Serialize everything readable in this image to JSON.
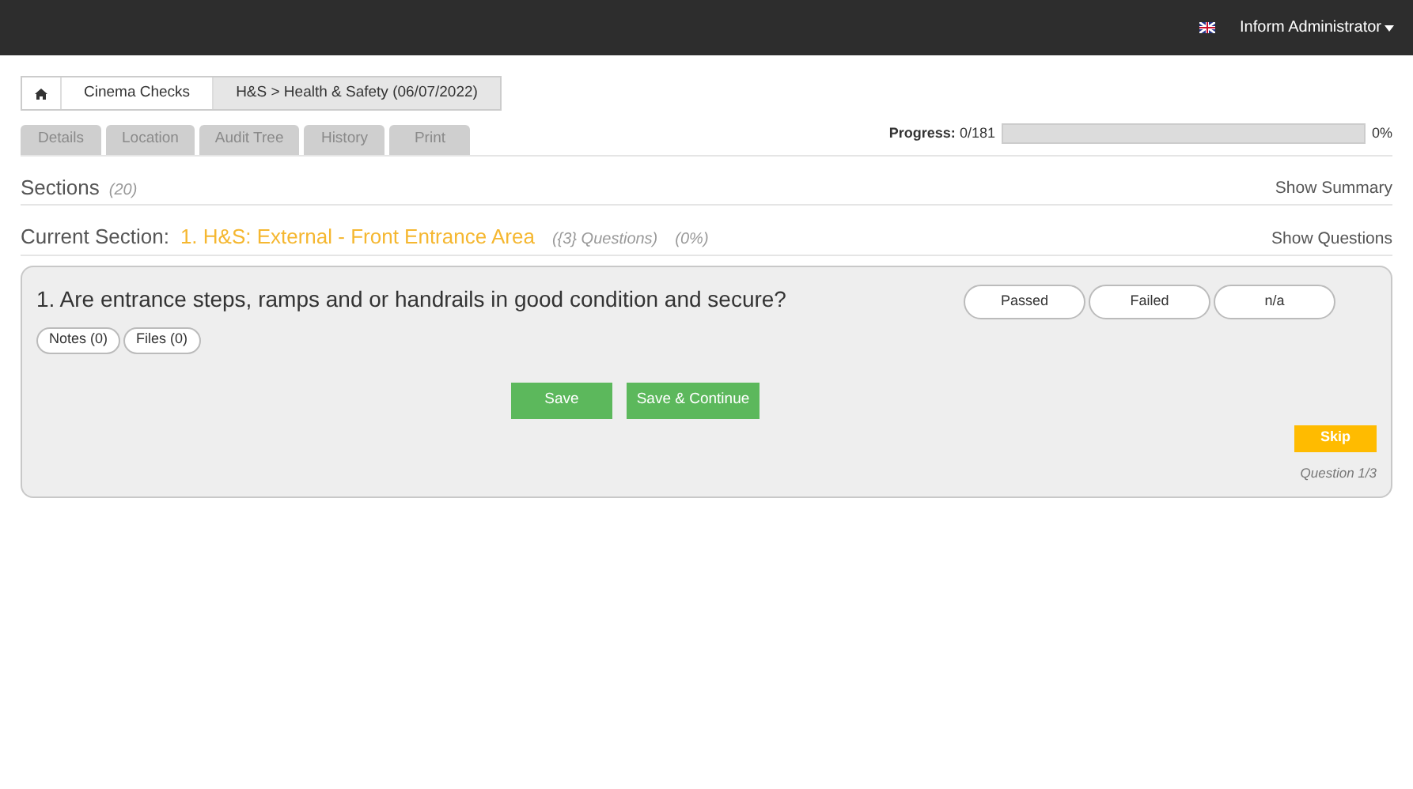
{
  "navbar": {
    "user": "Inform Administrator"
  },
  "breadcrumb": [
    {
      "label": "Cinema Checks",
      "selected": false
    },
    {
      "label": "H&S > Health & Safety (06/07/2022)",
      "selected": true
    }
  ],
  "tabs": [
    "Details",
    "Location",
    "Audit Tree",
    "History",
    "Print"
  ],
  "progress": {
    "label": "Progress:",
    "count": "0/181",
    "level": 0,
    "percent": "0%"
  },
  "sections": {
    "title": "Sections",
    "count": "(20)",
    "link": "Show Summary"
  },
  "current_section": {
    "label": "Current Section:",
    "name": "1. H&S: External - Front Entrance Area",
    "questions": "({3} Questions)",
    "percent": "(0%)",
    "link": "Show Questions"
  },
  "question": {
    "text": "1. Are entrance steps, ramps and or handrails in good condition and secure?",
    "answers": [
      {
        "label": "Passed",
        "selected": false
      },
      {
        "label": "Failed",
        "selected": false
      },
      {
        "label": "n/a",
        "selected": false
      }
    ],
    "attachments": [
      "Notes (0)",
      "Files (0)"
    ],
    "buttons": [
      "Save",
      "Save & Continue"
    ],
    "skip": "Skip",
    "position": "Question 1/3"
  }
}
